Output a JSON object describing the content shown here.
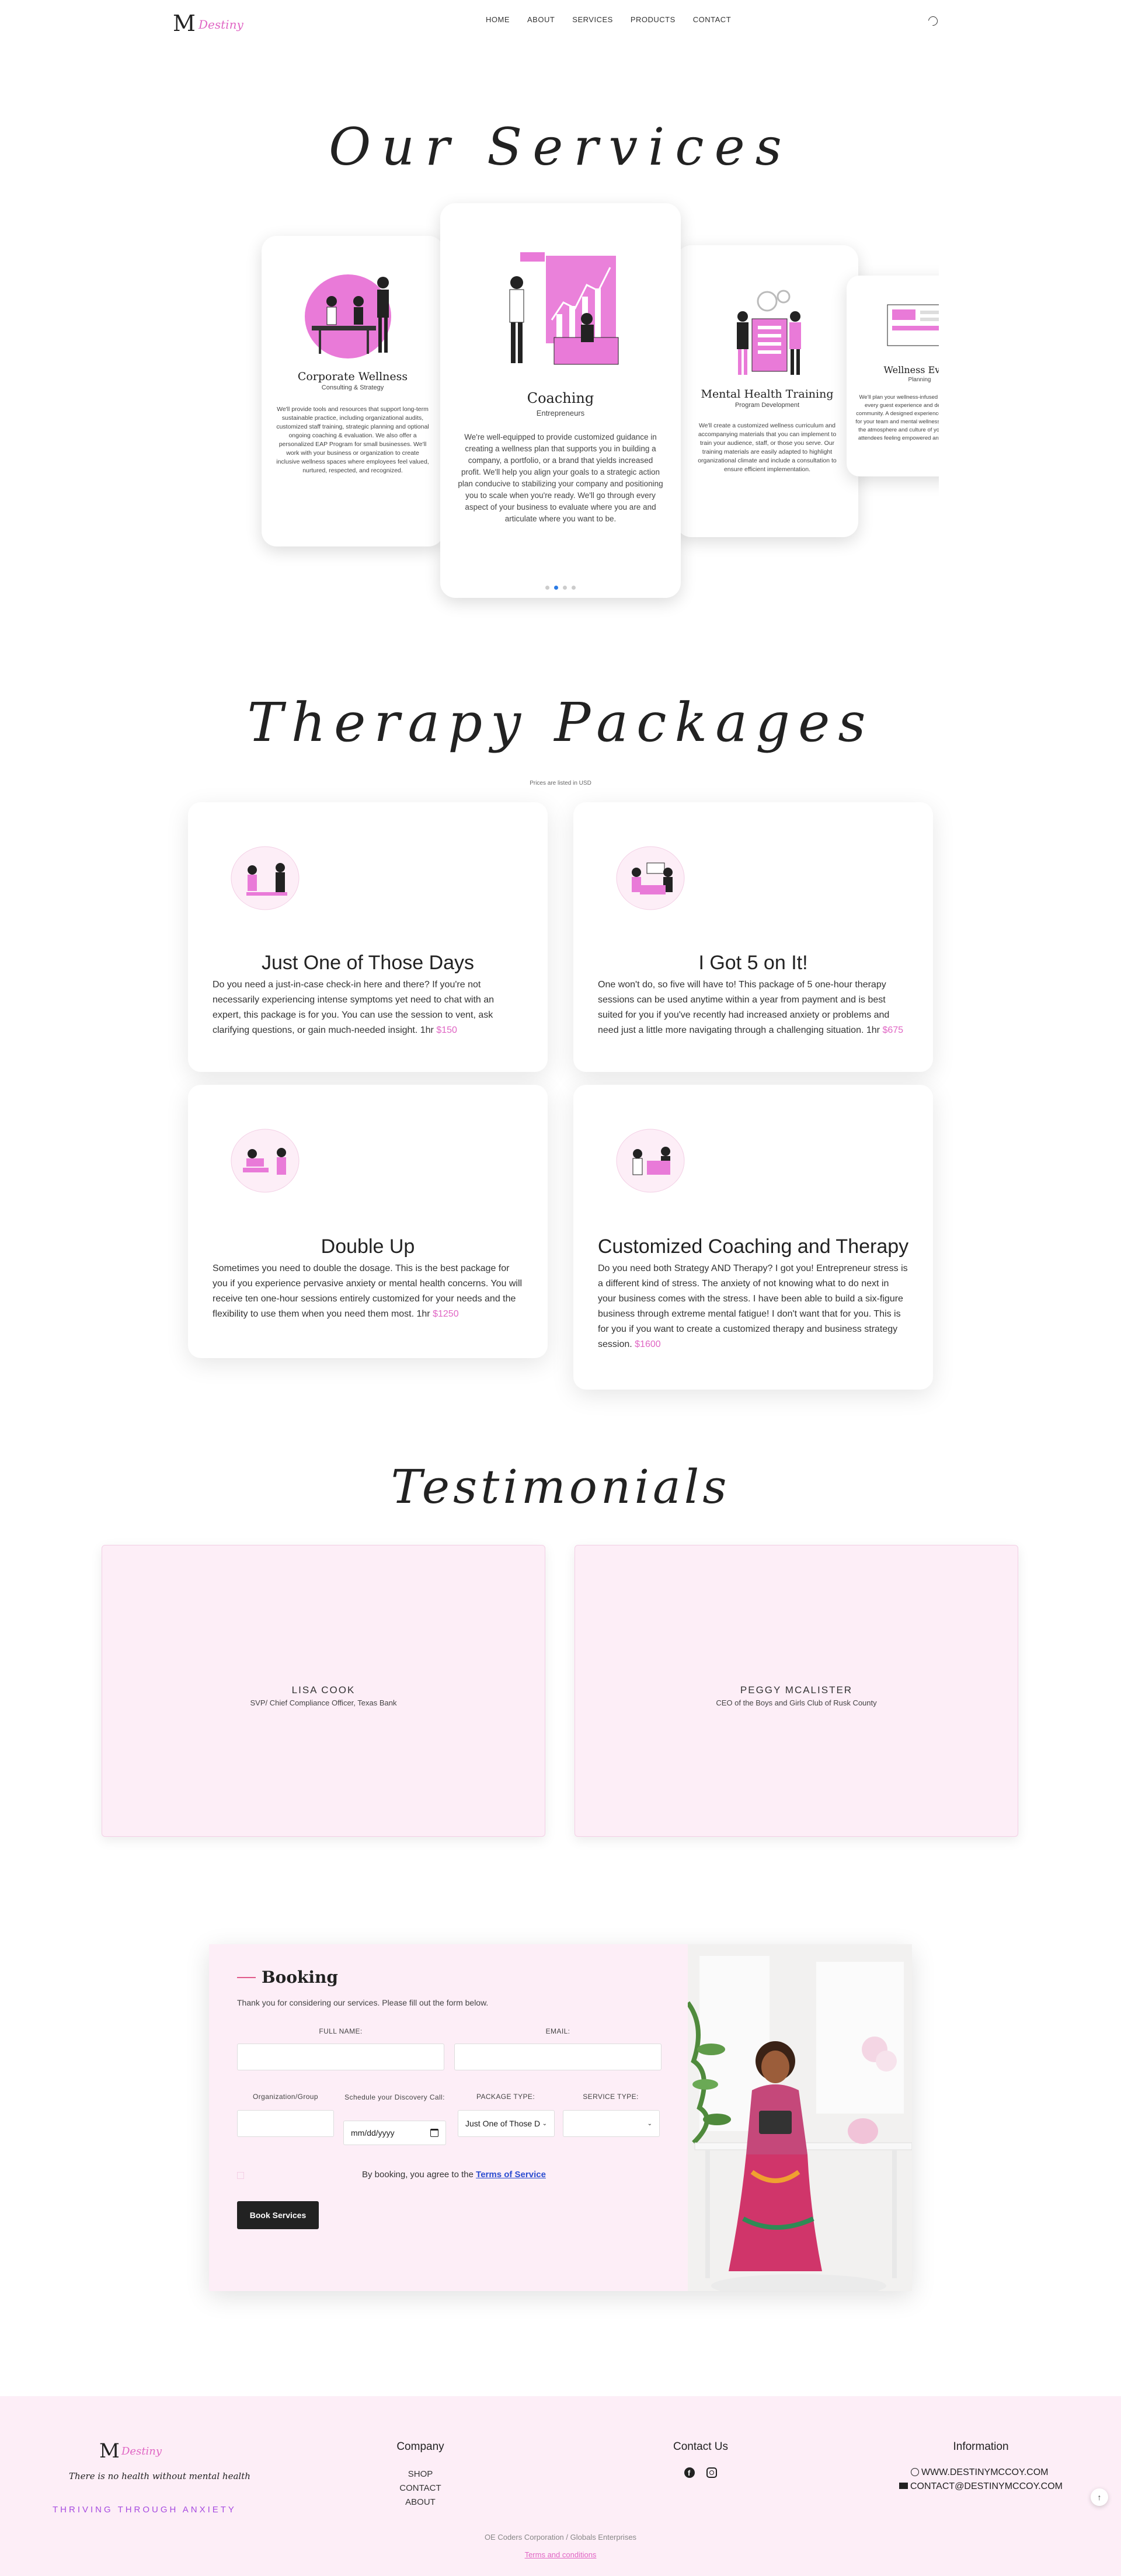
{
  "nav": {
    "logo_mark": "M",
    "logo_script": "Destiny",
    "links": [
      "HOME",
      "ABOUT",
      "SERVICES",
      "PRODUCTS",
      "CONTACT"
    ],
    "theme_icon": "moon-icon"
  },
  "services": {
    "title": "Our Services",
    "cards": [
      {
        "title": "Corporate Wellness",
        "subtitle": "Consulting & Strategy",
        "body": "We'll provide tools and resources that support long-term sustainable practice, including organizational audits, customized staff training, strategic planning and optional ongoing coaching & evaluation. We also offer a personalized EAP Program for small businesses. We'll work with your business or organization to create inclusive wellness spaces where employees feel valued, nurtured, respected, and recognized."
      },
      {
        "title": "Coaching",
        "subtitle": "Entrepreneurs",
        "body": "We're well-equipped to provide customized guidance in creating a wellness plan that supports you in building a company, a portfolio, or a brand that yields increased profit. We'll help you align your goals to a strategic action plan conducive to stabilizing your company and positioning you to scale when you're ready. We'll go through every aspect of your business to evaluate where you are and articulate where you want to be."
      },
      {
        "title": "Mental Health Training",
        "subtitle": "Program Development",
        "body": "We'll create a customized wellness curriculum and accompanying materials that you can implement to train your audience, staff, or those you serve. Our training materials are easily adapted to highlight organizational climate and include a consultation to ensure efficient implementation."
      },
      {
        "title": "Wellness Event",
        "subtitle": "Planning",
        "body": "We'll plan your wellness-infused events, ensuring every guest experience and detail that builds community. A designed experience, we will show up for your team and mental wellness best practice into the atmosphere and culture of your group, leaving attendees feeling empowered and excited about..."
      }
    ]
  },
  "packages": {
    "title": "Therapy Packages",
    "subtitle": "Prices are listed in USD",
    "cards": [
      {
        "title": "Just One of Those Days",
        "body": "Do you need a just-in-case check-in here and there? If you're not necessarily experiencing intense symptoms yet need to chat with an expert, this package is for you. You can use the session to vent, ask clarifying questions, or gain much-needed insight. 1hr",
        "price": "$150"
      },
      {
        "title": "I Got 5 on It!",
        "body": "One won't do, so five will have to! This package of 5 one-hour therapy sessions can be used anytime within a year from payment and is best suited for you if you've recently had increased anxiety or problems and need just a little more navigating through a challenging situation. 1hr",
        "price": "$675"
      },
      {
        "title": "Double Up",
        "body": "Sometimes you need to double the dosage. This is the best package for you if you experience pervasive anxiety or mental health concerns. You will receive ten one-hour sessions entirely customized for your needs and the flexibility to use them when you need them most. 1hr",
        "price": "$1250"
      },
      {
        "title": "Customized Coaching and Therapy",
        "body": "Do you need both Strategy AND Therapy? I got you! Entrepreneur stress is a different kind of stress. The anxiety of not knowing what to do next in your business comes with the stress. I have been able to build a six-figure business through extreme mental fatigue! I don't want that for you. This is for you if you want to create a customized therapy and business strategy session.",
        "price": "$1600"
      }
    ]
  },
  "testimonials": {
    "title": "Testimonials",
    "items": [
      {
        "name": "LISA COOK",
        "role": "SVP/ Chief Compliance Officer, Texas Bank"
      },
      {
        "name": "PEGGY MCALISTER",
        "role": "CEO of the Boys and Girls Club of Rusk County"
      }
    ]
  },
  "booking": {
    "title": "Booking",
    "intro": "Thank you for considering our services. Please fill out the form below.",
    "labels": {
      "full_name": "FULL NAME:",
      "email": "EMAIL:",
      "org": "Organization/Group",
      "discovery": "Schedule your Discovery Call:",
      "package_type": "PACKAGE TYPE:",
      "service_type": "SERVICE TYPE:"
    },
    "date_placeholder": "mm/dd/yyyy",
    "package_selected": "Just One of Those D",
    "agree_text": "By booking, you agree to the",
    "terms_link": "Terms of Service",
    "button": "Book Services"
  },
  "footer": {
    "tagline": "There is no health without mental health",
    "thriving": "THRIVING THROUGH ANXIETY",
    "company_title": "Company",
    "company_links": [
      "SHOP",
      "CONTACT",
      "ABOUT"
    ],
    "contact_title": "Contact Us",
    "info_title": "Information",
    "website": "WWW.DESTINYMCCOY.COM",
    "email": "CONTACT@DESTINYMCCOY.COM",
    "copyright": "OE Coders Corporation / Globals Enterprises",
    "terms": "Terms and conditions"
  },
  "colors": {
    "accent_pink": "#e066c4",
    "booking_bg": "#fdeef7",
    "dot_active": "#2c7be5"
  }
}
